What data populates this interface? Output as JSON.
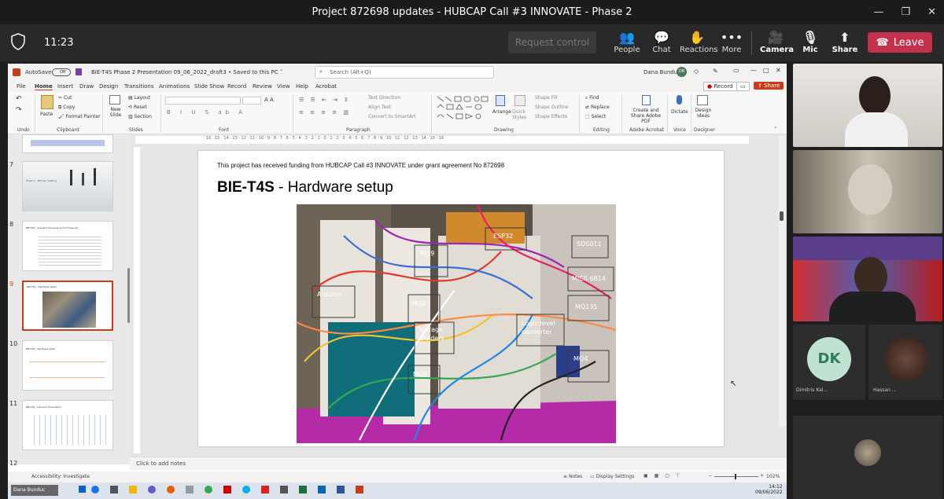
{
  "teams": {
    "window_title": "Project 872698 updates - HUBCAP Call #3 INNOVATE - Phase 2",
    "timer": "11:23",
    "request_control": "Request control",
    "tools": [
      {
        "label": "People",
        "icon": "people-icon"
      },
      {
        "label": "Chat",
        "icon": "chat-icon"
      },
      {
        "label": "Reactions",
        "icon": "reactions-icon"
      },
      {
        "label": "More",
        "icon": "more-icon"
      },
      {
        "label": "Camera",
        "icon": "camera-off-icon"
      },
      {
        "label": "Mic",
        "icon": "mic-off-icon"
      },
      {
        "label": "Share",
        "icon": "share-icon"
      }
    ],
    "leave_label": "Leave",
    "leave_color": "#c4314b"
  },
  "ppt": {
    "autosave_label": "AutoSave",
    "autosave_state": "Off",
    "doc_title": "BIE-T4S Phase 2 Presentation 09_06_2022_draft3 • Saved to this PC ˅",
    "search_placeholder": "Search (Alt+Q)",
    "user_name": "Dana Bunduc",
    "user_initials": "DB",
    "tabs": [
      "File",
      "Home",
      "Insert",
      "Draw",
      "Design",
      "Transitions",
      "Animations",
      "Slide Show",
      "Record",
      "Review",
      "View",
      "Help",
      "Acrobat"
    ],
    "active_tab": "Home",
    "record_btn": "Record",
    "share_btn": "Share",
    "ribbon": {
      "undo_label": "Undo",
      "paste": "Paste",
      "cut": "Cut",
      "copy": "Copy",
      "format_painter": "Format Painter",
      "clipboard_label": "Clipboard",
      "new_slide": "New Slide",
      "layout": "Layout",
      "reset": "Reset",
      "section": "Section",
      "slides_label": "Slides",
      "font_label": "Font",
      "text_direction": "Text Direction",
      "align_text": "Align Text",
      "convert_smartart": "Convert to SmartArt",
      "paragraph_label": "Paragraph",
      "arrange": "Arrange",
      "quick_styles": "Quick Styles",
      "shape_fill": "Shape Fill",
      "shape_outline": "Shape Outline",
      "shape_effects": "Shape Effects",
      "drawing_label": "Drawing",
      "find": "Find",
      "replace": "Replace",
      "select": "Select",
      "editing_label": "Editing",
      "create_share_pdf": "Create and Share Adobe PDF",
      "adobe_label": "Adobe Acrobat",
      "dictate": "Dictate",
      "voice_label": "Voice",
      "design_ideas": "Design Ideas",
      "designer_label": "Designer"
    },
    "ruler_text": "16 · 15 · 14 · 13 · 12 · 11 · 10 · 9 · 8 · 7 · 6 · 5 · 4 · 3 · 2 · 1 · 0 · 1 · 2 · 3 · 4 · 5 · 6 · 7 · 8 · 9 · 10 · 11 · 12 · 13 · 14 · 15 · 16",
    "thumbnails": [
      {
        "num": "7",
        "title": "Phase 2 - Partner meeting"
      },
      {
        "num": "8",
        "title": "BIE-T4S - Scenario planning and IoT Devices"
      },
      {
        "num": "9",
        "title": "BIE-T4S - Hardware setup"
      },
      {
        "num": "10",
        "title": "BIE-T4S - Hardware tests"
      },
      {
        "num": "11",
        "title": "BIE-T4S - Dynamic Evacuation"
      },
      {
        "num": "12",
        "title": ""
      }
    ],
    "active_thumb": "9",
    "slide": {
      "funding_text": "This project has received funding from HUBCAP Call #3 INNOVATE under grant agreement No 872698",
      "title_bold": "BIE-T4S",
      "title_rest": " - Hardware setup",
      "labels": [
        "Arduino",
        "MQ9",
        "MQ2",
        "Voltage dividers",
        "MQ6",
        "ESP32",
        "SDS011",
        "MICS 6814",
        "MQ135",
        "Logic level converter",
        "MQ4"
      ]
    },
    "notes_placeholder": "Click to add notes",
    "status": {
      "accessibility": "Accessibility: Investigate",
      "notes": "Notes",
      "display_settings": "Display Settings",
      "zoom": "102%"
    },
    "taskbar": {
      "time": "14:12",
      "date": "09/06/2022"
    }
  },
  "participants": [
    {
      "name": "",
      "kind": "video"
    },
    {
      "name": "",
      "kind": "video"
    },
    {
      "name": "",
      "kind": "video"
    },
    {
      "name": "Dimitris Kal...",
      "initials": "DK",
      "kind": "avatar"
    },
    {
      "name": "Hassan ...",
      "kind": "avatar-photo"
    },
    {
      "name": "",
      "kind": "avatar-photo"
    }
  ],
  "presenter_name": "Dana Bunduc"
}
